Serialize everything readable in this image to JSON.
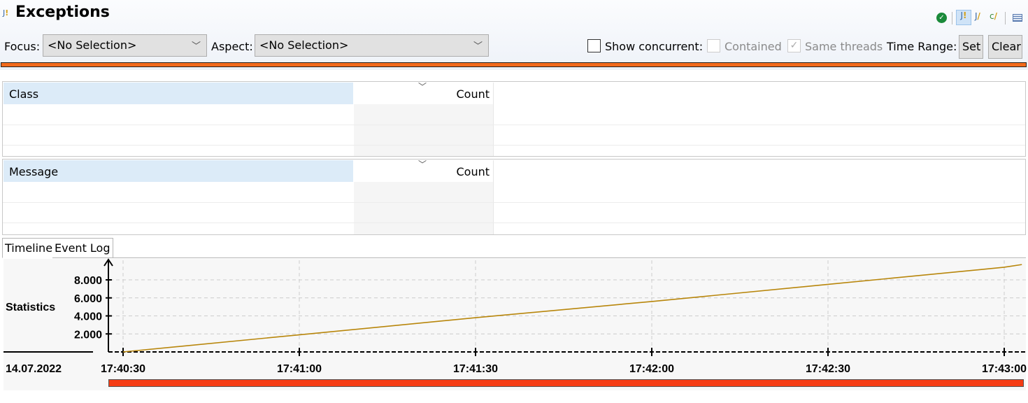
{
  "header": {
    "title": "Exceptions",
    "app_icon": "java-exception-icon",
    "toolbar_icons": [
      "ok-check-icon",
      "class-exception-icon",
      "exception-icon",
      "class-exception-edit-icon",
      "table-layout-icon"
    ]
  },
  "filter": {
    "focus_label": "Focus:",
    "focus_value": "<No Selection>",
    "aspect_label": "Aspect:",
    "aspect_value": "<No Selection>",
    "show_concurrent": "Show concurrent:",
    "show_concurrent_checked": false,
    "contained": "Contained",
    "contained_checked": false,
    "same_threads": "Same threads",
    "same_threads_checked": true,
    "time_range": "Time Range:",
    "set": "Set",
    "clear": "Clear"
  },
  "class_table": {
    "col1": "Class",
    "col2": "Count"
  },
  "message_table": {
    "col1": "Message",
    "col2": "Count"
  },
  "tabs": [
    {
      "label": "Timeline",
      "active": true
    },
    {
      "label": "Event Log",
      "active": false
    }
  ],
  "chart_data": {
    "type": "line",
    "row_label": "Statistics",
    "date": "14.07.2022",
    "x_ticks": [
      "17:40:30",
      "17:41:00",
      "17:41:30",
      "17:42:00",
      "17:42:30",
      "17:43:00"
    ],
    "y_ticks": [
      "2.000",
      "4.000",
      "6.000",
      "8.000"
    ],
    "ylim": [
      0,
      9800
    ],
    "grid": true,
    "color": "#b8860b",
    "x": [
      "17:40:30",
      "17:41:00",
      "17:41:30",
      "17:42:00",
      "17:42:30",
      "17:43:00",
      "17:43:03"
    ],
    "values": [
      0,
      1900,
      3800,
      5600,
      7500,
      9400,
      9700
    ]
  },
  "colors": {
    "accent": "#f26a1b",
    "range_bar": "#f53c14"
  }
}
